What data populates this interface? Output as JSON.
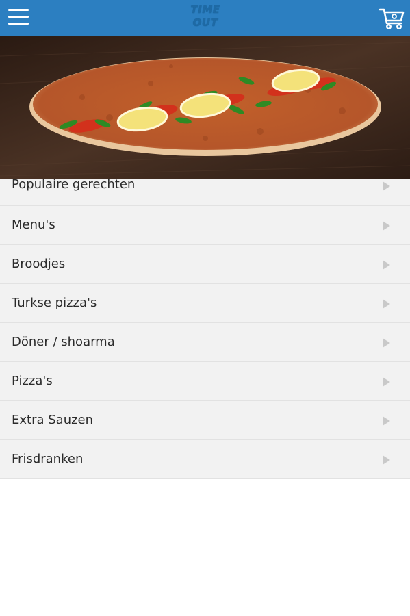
{
  "header": {
    "logo_line1": "TIME",
    "logo_line2": "OUT",
    "menu_icon": "hamburger-menu-icon",
    "cart_icon": "shopping-cart-icon",
    "bar_color": "#2c7fc1"
  },
  "hero": {
    "image": "turkish-pizza-photo"
  },
  "categories": [
    {
      "label": "Populaire gerechten"
    },
    {
      "label": "Menu's"
    },
    {
      "label": "Broodjes"
    },
    {
      "label": "Turkse pizza's"
    },
    {
      "label": "Döner / shoarma"
    },
    {
      "label": "Pizza's"
    },
    {
      "label": "Extra Sauzen"
    },
    {
      "label": "Frisdranken"
    }
  ]
}
